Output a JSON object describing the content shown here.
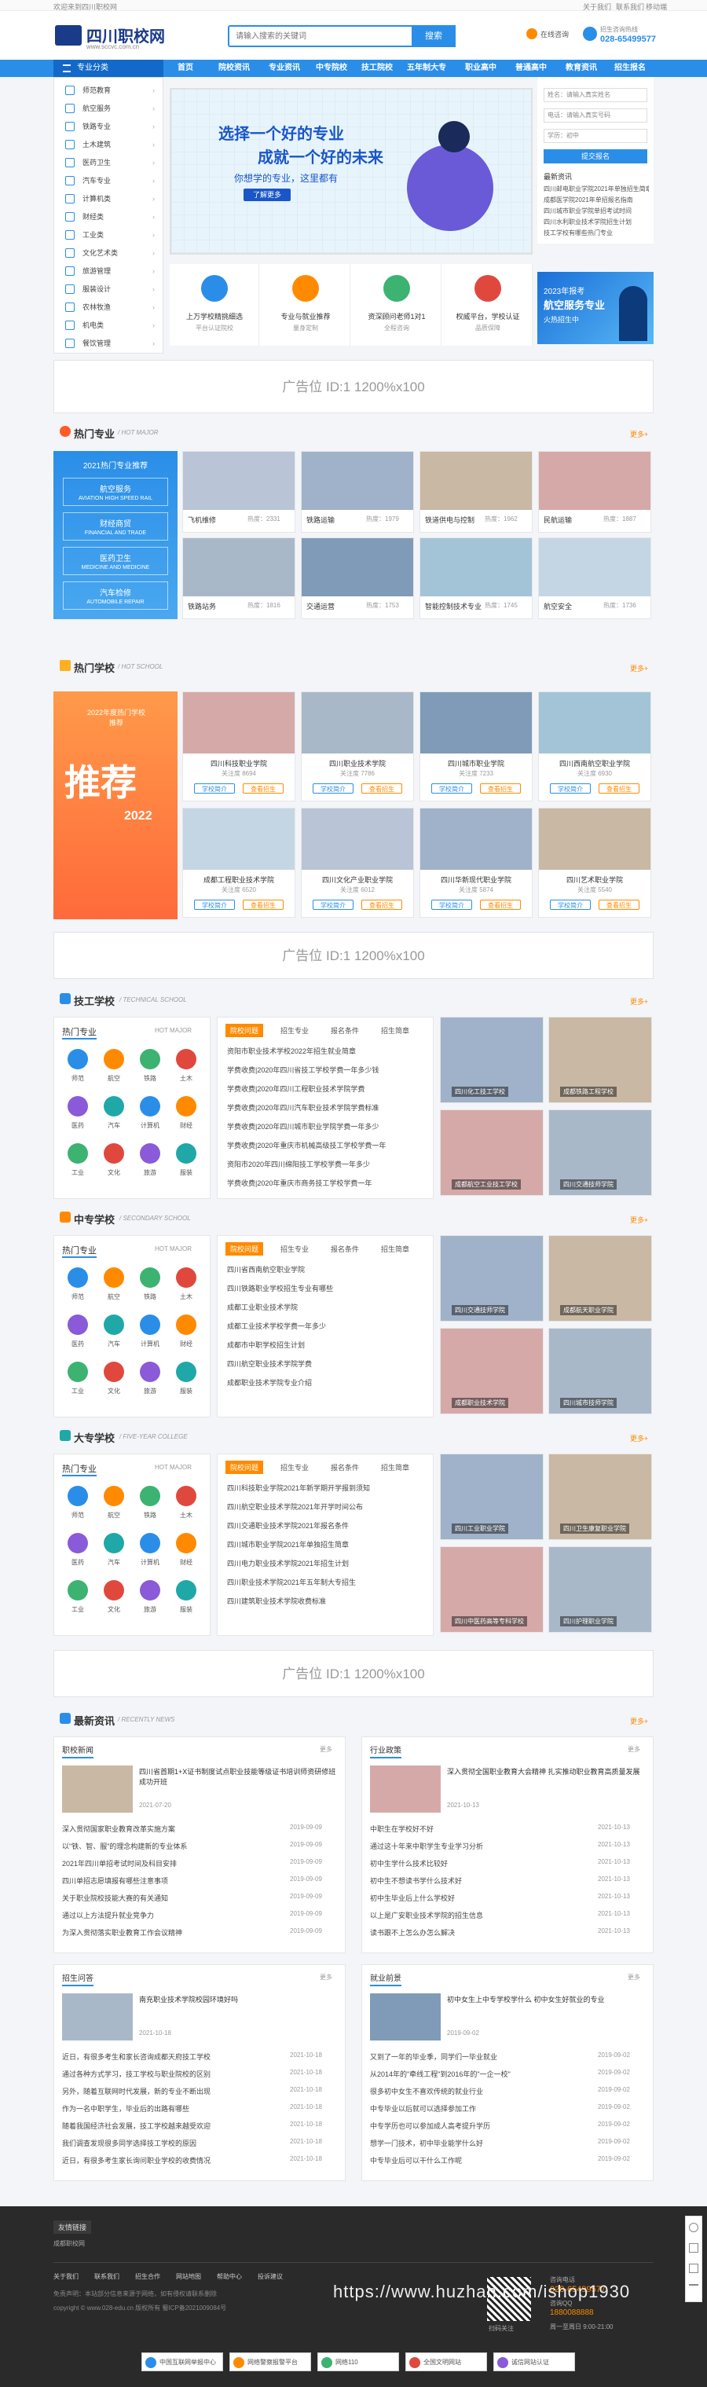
{
  "topbar": {
    "welcome": "欢迎来到四川职校网",
    "links": [
      "关于我们",
      "联系我们",
      "移动端"
    ]
  },
  "header": {
    "logo_title": "四川职校网",
    "logo_url": "www.sccvc.com.cn",
    "search_placeholder": "请输入搜索的关键词",
    "search_button": "搜索",
    "consult_label": "在线咨询",
    "phone_label": "招生咨询热线",
    "phone": "028-65499577",
    "icon_hot": "hot-icon"
  },
  "nav": {
    "category": "专业分类",
    "items": [
      "首页",
      "院校资讯",
      "专业资讯",
      "中专院校",
      "技工院校",
      "五年制大专",
      "职业高中",
      "普通高中",
      "教育资讯",
      "招生报名"
    ]
  },
  "sidebar": {
    "items": [
      "师范教育",
      "航空服务",
      "铁路专业",
      "土木建筑",
      "医药卫生",
      "汽车专业",
      "计算机类",
      "财经类",
      "工业类",
      "文化艺术类",
      "旅游管理",
      "服装设计",
      "农林牧渔",
      "机电类",
      "餐饮管理"
    ]
  },
  "banner": {
    "title": "选择一个好的专业",
    "subtitle": "成就一个好的未来",
    "tagline": "你想学的专业，这里都有",
    "button": "了解更多"
  },
  "form": {
    "name_ph": "姓名：请输入真实姓名",
    "phone_ph": "电话：请输入真实号码",
    "edu_label": "学历：初中",
    "submit": "提交报名",
    "news_title": "最新资讯",
    "news": [
      "四川邮电职业学院2021年单独招生简章",
      "成都医学院2021年单招报名指南",
      "四川城市职业学院单招考试时间",
      "四川水利职业技术学院招生计划",
      "技工学校有哪些热门专业"
    ]
  },
  "features": [
    {
      "label": "上万学校精挑细选",
      "sub": "平台认证院校",
      "icon": "shield-icon"
    },
    {
      "label": "专业与就业推荐",
      "sub": "量身定制",
      "icon": "graduate-icon"
    },
    {
      "label": "资深顾问老师1对1",
      "sub": "全程咨询",
      "icon": "teacher-icon"
    },
    {
      "label": "权威平台，学校认证",
      "sub": "品质保障",
      "icon": "shield-check-icon"
    }
  ],
  "promo": {
    "year": "2023年报考",
    "title": "航空服务专业",
    "sub": "火热招生中"
  },
  "ad": {
    "text": "广告位 ID:1 1200%x100"
  },
  "hot_major": {
    "title": "热门专业",
    "sub": "/ HOT MAJOR",
    "more": "更多+",
    "left_title": "2021热门专业推荐",
    "left_items": [
      "航空服务",
      "财经商贸",
      "医药卫生",
      "汽车检修"
    ],
    "left_subs": [
      "AVIATION HIGH SPEED RAIL",
      "FINANCIAL AND TRADE",
      "MEDICINE AND MEDICINE",
      "AUTOMOBILE REPAIR"
    ],
    "tiles": [
      {
        "name": "飞机维修",
        "hot": "热度：2331"
      },
      {
        "name": "铁路运输",
        "hot": "热度：1979"
      },
      {
        "name": "铁道供电与控制",
        "hot": "热度：1962"
      },
      {
        "name": "民航运输",
        "hot": "热度：1887"
      },
      {
        "name": "铁路站务",
        "hot": "热度：1816"
      },
      {
        "name": "交通运营",
        "hot": "热度：1753"
      },
      {
        "name": "智能控制技术专业",
        "hot": "热度：1745"
      },
      {
        "name": "航空安全",
        "hot": "热度：1736"
      }
    ]
  },
  "hot_school": {
    "title": "热门学校",
    "sub": "/ HOT SCHOOL",
    "more": "更多+",
    "tuijian": "推荐",
    "year": "2022",
    "tags": [
      "2022年度热门学校推荐"
    ],
    "tiles": [
      {
        "name": "四川科技职业学院",
        "info": "关注度 8694"
      },
      {
        "name": "四川职业技术学院",
        "info": "关注度 7786"
      },
      {
        "name": "四川城市职业学院",
        "info": "关注度 7233"
      },
      {
        "name": "四川西南航空职业学院",
        "info": "关注度 6930"
      },
      {
        "name": "成都工程职业技术学院",
        "info": "关注度 6520"
      },
      {
        "name": "四川文化产业职业学院",
        "info": "关注度 6012"
      },
      {
        "name": "四川华新现代职业学院",
        "info": "关注度 5874"
      },
      {
        "name": "四川艺术职业学院",
        "info": "关注度 5540"
      }
    ],
    "btn_a": "学校简介",
    "btn_b": "查看招生"
  },
  "tech": {
    "title": "技工学校",
    "sub": "/ TECHNICAL SCHOOL",
    "more": "更多+",
    "hot_major": "热门专业",
    "hot_major_en": "HOT MAJOR",
    "tabs": [
      "院校问题",
      "招生专业",
      "报名条件",
      "招生简章"
    ],
    "news": [
      "资阳市职业技术学校2022年招生就业简章",
      "学费收费|2020年四川省技工学校学费一年多少钱",
      "学费收费|2020年四川工程职业技术学院学费",
      "学费收费|2020年四川汽车职业技术学院学费标准",
      "学费收费|2020年四川城市职业学院学费一年多少",
      "学费收费|2020年重庆市机械高级技工学校学费一年",
      "资阳市2020年四川绵阳技工学校学费一年多少",
      "学费收费|2020年重庆市商务技工学校学费一年"
    ],
    "photos": [
      "四川化工技工学校",
      "成都铁路工程学校",
      "成都航空工业技工学校",
      "四川交通技师学院"
    ]
  },
  "secondary": {
    "title": "中专学校",
    "sub": "/ SECONDARY SCHOOL",
    "more": "更多+",
    "hot_major": "热门专业",
    "hot_major_en": "HOT MAJOR",
    "tabs": [
      "院校问题",
      "招生专业",
      "报名条件",
      "招生简章"
    ],
    "news": [
      "四川省西南航空职业学院",
      "四川铁路职业学校招生专业有哪些",
      "成都工业职业技术学院",
      "成都工业技术学校学费一年多少",
      "成都市中职学校招生计划",
      "四川航空职业技术学院学费",
      "成都职业技术学院专业介绍"
    ],
    "photos": [
      "四川交通技师学院",
      "成都航天职业学院",
      "成都职业技术学院",
      "四川城市技师学院"
    ]
  },
  "college": {
    "title": "大专学校",
    "sub": "/ FIVE-YEAR COLLEGE",
    "more": "更多+",
    "hot_major": "热门专业",
    "hot_major_en": "HOT MAJOR",
    "tabs": [
      "院校问题",
      "招生专业",
      "报名条件",
      "招生简章"
    ],
    "news": [
      "四川科技职业学院2021年新学期开学报到须知",
      "四川航空职业技术学院2021年开学时间公布",
      "四川交通职业技术学院2021年报名条件",
      "四川城市职业学院2021年单独招生简章",
      "四川电力职业技术学院2021年招生计划",
      "四川职业技术学院2021年五年制大专招生",
      "四川建筑职业技术学院收费标准"
    ],
    "photos": [
      "四川工业职业学院",
      "四川卫生康复职业学院",
      "四川中医药高等专科学校",
      "四川护理职业学院"
    ]
  },
  "majors_icons": [
    "师范",
    "航空",
    "铁路",
    "土木",
    "医药",
    "汽车",
    "计算机",
    "财经",
    "工业",
    "文化",
    "旅游",
    "服装"
  ],
  "news": {
    "title": "最新资讯",
    "sub": "/ RECENTLY NEWS",
    "more": "更多+",
    "boxes": [
      {
        "tab": "职校新闻",
        "more": "更多",
        "lead": "四川省首期1+X证书制度试点职业技能等级证书培训师资研修班成功开班",
        "date": "2021-07-20",
        "items": [
          "深入贯彻国家职业教育改革实施方案",
          "以\"铁、智、服\"的理念构建新的专业体系",
          "2021年四川单招考试时间及科目安排",
          "四川单招志愿填报有哪些注意事项",
          "关于职业院校技能大赛的有关通知",
          "通过以上方法提升就业竞争力",
          "为深入贯彻落实职业教育工作会议精神"
        ],
        "dates": [
          "2019-09-09",
          "2019-09-09",
          "2019-09-09",
          "2019-09-09",
          "2019-09-09",
          "2019-09-09",
          "2019-09-09"
        ]
      },
      {
        "tab": "行业政策",
        "more": "更多",
        "lead": "深入贯彻全国职业教育大会精神 扎实推动职业教育高质量发展",
        "date": "2021-10-13",
        "items": [
          "中职生在学校好不好",
          "通过这十年来中职学生专业学习分析",
          "初中生学什么技术比较好",
          "初中生不想读书学什么技术好",
          "初中生毕业后上什么学校好",
          "以上是广安职业技术学院的招生信息",
          "读书跟不上怎么办怎么解决"
        ],
        "dates": [
          "2021-10-13",
          "2021-10-13",
          "2021-10-13",
          "2021-10-13",
          "2021-10-13",
          "2021-10-13",
          "2021-10-13"
        ]
      },
      {
        "tab": "招生问答",
        "more": "更多",
        "lead": "南充职业技术学院校园环境好吗",
        "date": "2021-10-18",
        "items": [
          "近日，有很多考生和家长咨询成都天府技工学校",
          "通过各种方式学习，技工学校与职业院校的区别",
          "另外，随着互联网时代发展，新的专业不断出现",
          "作为一名中职学生，毕业后的出路有哪些",
          "随着我国经济社会发展，技工学校越来越受欢迎",
          "我们调查发现很多同学选择技工学校的原因",
          "近日，有很多考生家长询问职业学校的收费情况"
        ],
        "dates": [
          "2021-10-18",
          "2021-10-18",
          "2021-10-18",
          "2021-10-18",
          "2021-10-18",
          "2021-10-18",
          "2021-10-18"
        ]
      },
      {
        "tab": "就业前景",
        "more": "更多",
        "lead": "初中女生上中专学校学什么 初中女生好就业的专业",
        "date": "2019-09-02",
        "items": [
          "又到了一年的毕业季，同学们一毕业就业",
          "从2014年的\"牵线工程\"到2016年的\"一企一校\"",
          "很多初中女生不喜欢传统的就业行业",
          "中专毕业以后就可以选择参加工作",
          "中专学历也可以参加成人高考提升学历",
          "想学一门技术，初中毕业能学什么好",
          "中专毕业后可以干什么工作呢"
        ],
        "dates": [
          "2019-09-02",
          "2019-09-02",
          "2019-09-02",
          "2019-09-02",
          "2019-09-02",
          "2019-09-02",
          "2019-09-02"
        ]
      }
    ]
  },
  "footer": {
    "links_title": "友情链接",
    "links": [
      "成都职校网"
    ],
    "nav": [
      "关于我们",
      "联系我们",
      "招生合作",
      "网站地图",
      "帮助中心",
      "投诉建议"
    ],
    "copyright": "copyright © www.028-edu.cn 版权所有 蜀ICP备2021009084号",
    "disclaimer": "免责声明：本站部分信息来源于网络，如有侵权请联系删除",
    "consult": "咨询电话",
    "phone": "028-65499577",
    "contact_label": "咨询QQ",
    "qq": "1880088888",
    "hours": "周一至周日 9:00-21:00",
    "qr_label": "扫码关注",
    "watermark": "https://www.huzhan.com/ishop1930",
    "badges": [
      "中国互联网举报中心",
      "网络警察报警平台",
      "网络110",
      "全国文明网站",
      "诚信网站认证"
    ]
  }
}
